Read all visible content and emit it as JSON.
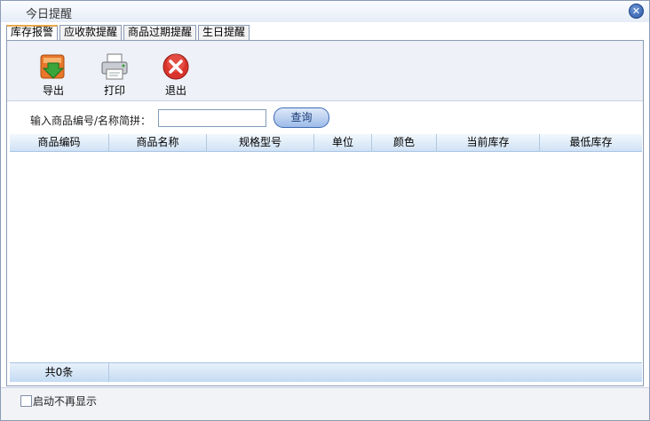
{
  "window": {
    "title": "今日提醒"
  },
  "tabs": [
    {
      "label": "库存报警",
      "active": true
    },
    {
      "label": "应收款提醒",
      "active": false
    },
    {
      "label": "商品过期提醒",
      "active": false
    },
    {
      "label": "生日提醒",
      "active": false
    }
  ],
  "toolbar": {
    "export_label": "导出",
    "print_label": "打印",
    "exit_label": "退出"
  },
  "search": {
    "label": "输入商品编号/名称简拼：",
    "value": "",
    "button_label": "查询"
  },
  "grid": {
    "columns": [
      "商品编码",
      "商品名称",
      "规格型号",
      "单位",
      "颜色",
      "当前库存",
      "最低库存"
    ],
    "rows": [],
    "footer_count": "共0条"
  },
  "footer": {
    "checkbox_label": "启动不再显示",
    "checked": false
  },
  "colors": {
    "accent": "#2b59a8",
    "header_bg": "#cfe2f5",
    "tab_active_border": "#e8a84a"
  }
}
